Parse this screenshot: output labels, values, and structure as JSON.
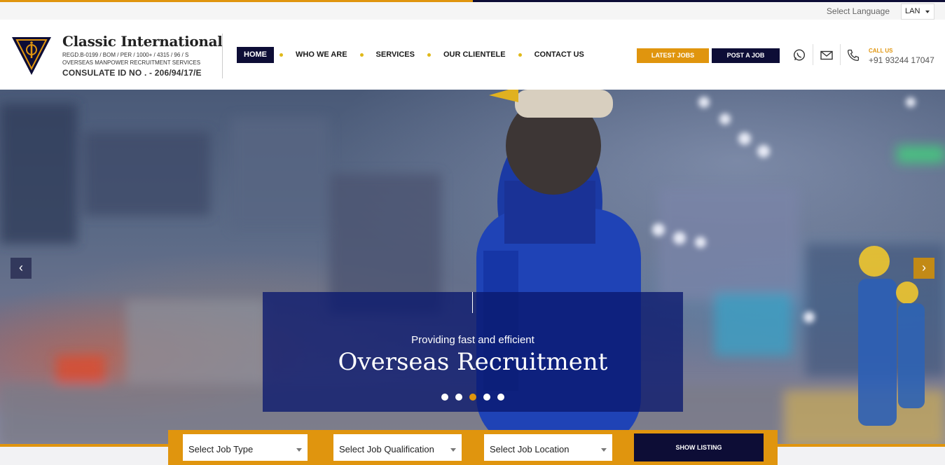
{
  "language": {
    "label": "Select Language",
    "selected": "LAN"
  },
  "brand": {
    "name": "Classic International",
    "reg": "REGD.B-0199 / BOM / PER / 1000+ / 4315 / 96 / S",
    "subtitle": "OVERSEAS MANPOWER RECRUITMENT SERVICES",
    "consulate": "CONSULATE ID NO . - 206/94/17/E"
  },
  "nav": {
    "items": [
      {
        "label": "HOME",
        "active": true
      },
      {
        "label": "WHO WE ARE"
      },
      {
        "label": "SERVICES"
      },
      {
        "label": "OUR CLIENTELE"
      },
      {
        "label": "CONTACT US"
      }
    ]
  },
  "actions": {
    "latest_jobs": "LATEST JOBS",
    "post_job": "POST A JOB"
  },
  "contact": {
    "call_label": "CALL US",
    "phone": "+91 93244 17047"
  },
  "hero": {
    "small_text": "Providing fast and efficient",
    "headline": "Overseas Recruitment",
    "slides": 5,
    "active_slide": 3
  },
  "search": {
    "job_type": "Select Job Type",
    "job_qualification": "Select Job Qualification",
    "job_location": "Select Job Location",
    "button": "SHOW LISTING"
  },
  "colors": {
    "gold": "#e0950e",
    "navy": "#0d0d36",
    "caption_bg": "#0a186e"
  }
}
